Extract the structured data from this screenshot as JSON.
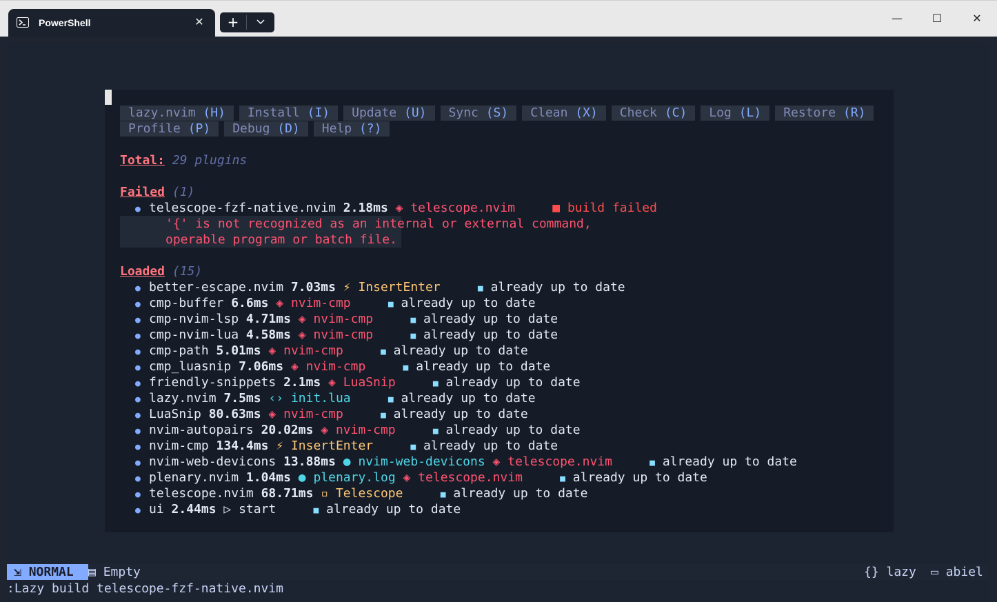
{
  "window": {
    "tab_title": "PowerShell",
    "tab_close": "✕",
    "new_tab": "+",
    "dropdown": "⌄",
    "minimize": "—",
    "maximize": "☐",
    "close": "✕"
  },
  "lazy": {
    "buttons_row1": [
      {
        "label": "lazy.nvim",
        "key": "(H)"
      },
      {
        "label": "Install",
        "key": "(I)"
      },
      {
        "label": "Update",
        "key": "(U)"
      },
      {
        "label": "Sync",
        "key": "(S)"
      },
      {
        "label": "Clean",
        "key": "(X)"
      },
      {
        "label": "Check",
        "key": "(C)"
      },
      {
        "label": "Log",
        "key": "(L)"
      },
      {
        "label": "Restore",
        "key": "(R)"
      }
    ],
    "buttons_row2": [
      {
        "label": "Profile",
        "key": "(P)"
      },
      {
        "label": "Debug",
        "key": "(D)"
      },
      {
        "label": "Help",
        "key": "(?)"
      }
    ],
    "total_label": "Total:",
    "total_value": "29 plugins",
    "failed_label": "Failed",
    "failed_count": "(1)",
    "failed": {
      "name": "telescope-fzf-native.nvim",
      "time": "2.18ms",
      "source_icon": "📦",
      "source": "telescope.nvim",
      "status": "build failed",
      "error_line1": "'{' is not recognized as an internal or external command,",
      "error_line2": "operable program or batch file."
    },
    "loaded_label": "Loaded",
    "loaded_count": "(15)",
    "plugins": [
      {
        "name": "better-escape.nvim",
        "time": "7.03ms",
        "icon": "⚡",
        "src": "InsertEnter",
        "status": "already up to date"
      },
      {
        "name": "cmp-buffer",
        "time": "6.6ms",
        "icon": "◈",
        "src": "nvim-cmp",
        "status": "already up to date"
      },
      {
        "name": "cmp-nvim-lsp",
        "time": "4.71ms",
        "icon": "◈",
        "src": "nvim-cmp",
        "status": "already up to date"
      },
      {
        "name": "cmp-nvim-lua",
        "time": "4.58ms",
        "icon": "◈",
        "src": "nvim-cmp",
        "status": "already up to date"
      },
      {
        "name": "cmp-path",
        "time": "5.01ms",
        "icon": "◈",
        "src": "nvim-cmp",
        "status": "already up to date"
      },
      {
        "name": "cmp_luasnip",
        "time": "7.06ms",
        "icon": "◈",
        "src": "nvim-cmp",
        "status": "already up to date"
      },
      {
        "name": "friendly-snippets",
        "time": "2.1ms",
        "icon": "◈",
        "src": "LuaSnip",
        "status": "already up to date"
      },
      {
        "name": "lazy.nvim",
        "time": "7.5ms",
        "icon": "‹›",
        "src": "init.lua",
        "status": "already up to date"
      },
      {
        "name": "LuaSnip",
        "time": "80.63ms",
        "icon": "◈",
        "src": "nvim-cmp",
        "status": "already up to date"
      },
      {
        "name": "nvim-autopairs",
        "time": "20.02ms",
        "icon": "◈",
        "src": "nvim-cmp",
        "status": "already up to date"
      },
      {
        "name": "nvim-cmp",
        "time": "134.4ms",
        "icon": "⚡",
        "src": "InsertEnter",
        "status": "already up to date"
      },
      {
        "name": "nvim-web-devicons",
        "time": "13.88ms",
        "icon": "●",
        "src": "nvim-web-devicons",
        "icon2": "◈",
        "src2": "telescope.nvim",
        "status": "already up to date"
      },
      {
        "name": "plenary.nvim",
        "time": "1.04ms",
        "icon": "●",
        "src": "plenary.log",
        "icon2": "◈",
        "src2": "telescope.nvim",
        "status": "already up to date"
      },
      {
        "name": "telescope.nvim",
        "time": "68.71ms",
        "icon": "▫",
        "src": "Telescope",
        "status": "already up to date"
      },
      {
        "name": "ui",
        "time": "2.44ms",
        "icon": "▷",
        "src": "start",
        "status": "already up to date"
      }
    ]
  },
  "statusline": {
    "mode": "NORMAL",
    "file": "Empty",
    "right1": "{} lazy",
    "right2": "abiel"
  },
  "cmdline": ":Lazy build telescope-fzf-native.nvim",
  "colors": {
    "accent": "#82aaff",
    "header": "#ff757f",
    "error": "#ff4d4d",
    "background": "#1c2431"
  }
}
